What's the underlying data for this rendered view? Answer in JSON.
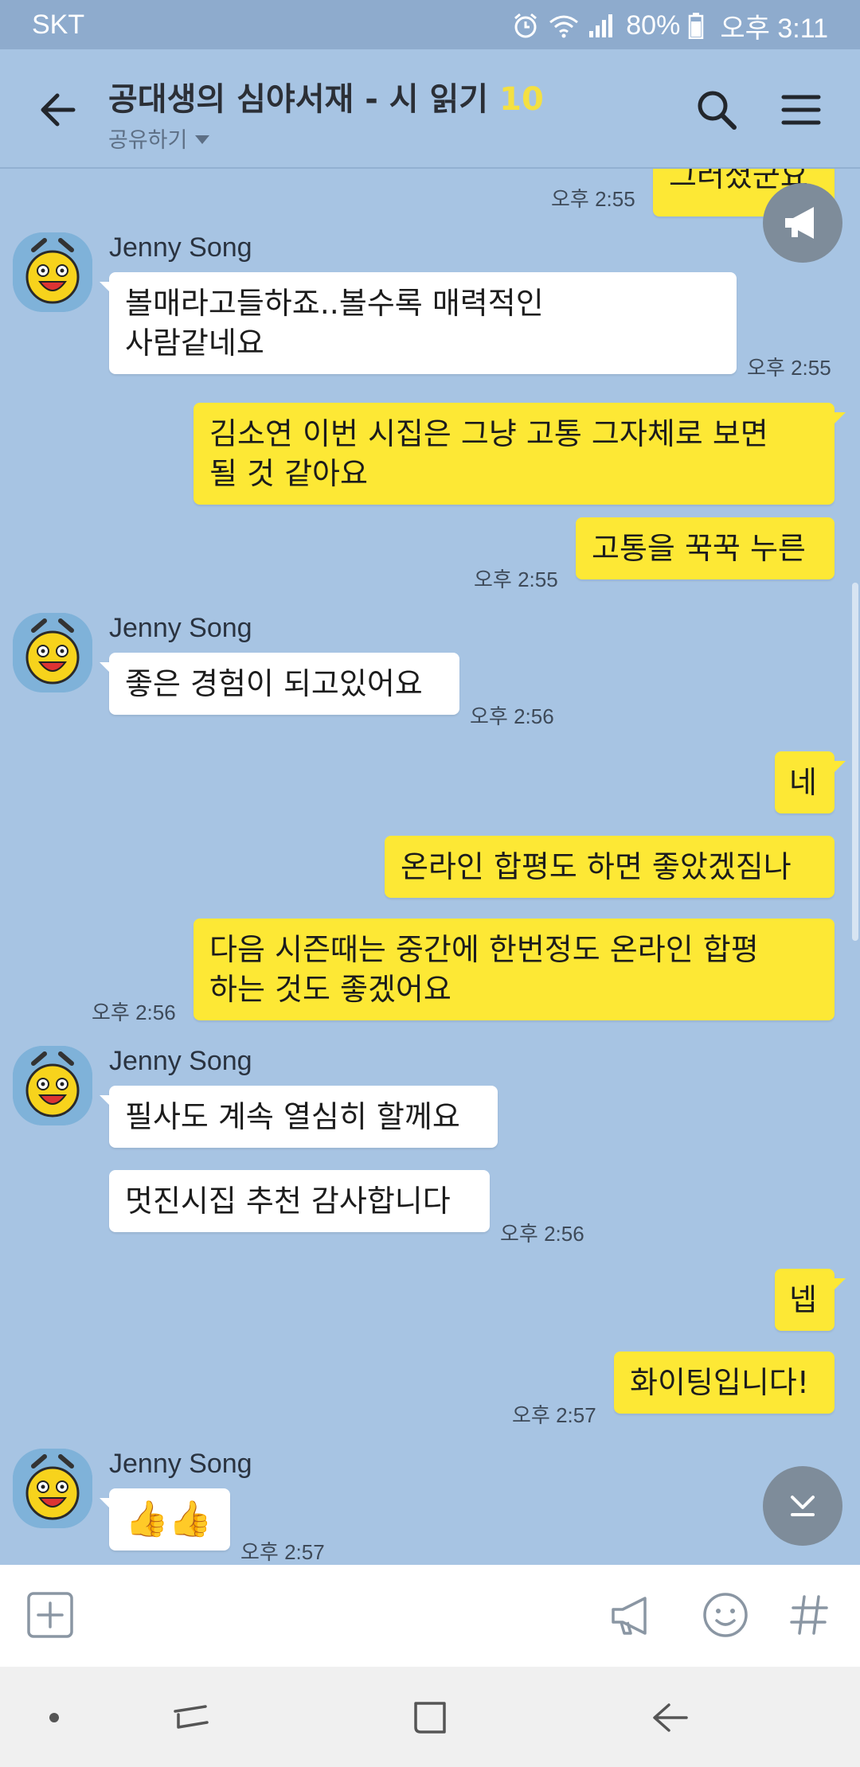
{
  "status_bar": {
    "carrier": "SKT",
    "battery": "80%",
    "time": "오후 3:11"
  },
  "header": {
    "title": "공대생의 심야서재 - 시 읽기",
    "member_count": "10",
    "share_label": "공유하기"
  },
  "messages": [
    {
      "from": "me",
      "text": "그러셨군요",
      "time": "오후 2:55"
    },
    {
      "from": "other",
      "sender": "Jenny Song",
      "text_lines": [
        "볼매라고들하죠..볼수록 매력적인",
        "사람같네요"
      ],
      "time": "오후 2:55"
    },
    {
      "from": "me",
      "text_lines": [
        "김소연 이번 시집은 그냥 고통 그자체로 보면",
        "될 것 같아요"
      ]
    },
    {
      "from": "me",
      "text": "고통을 꾹꾹 누른",
      "time": "오후 2:55"
    },
    {
      "from": "other",
      "sender": "Jenny Song",
      "text": "좋은 경험이 되고있어요",
      "time": "오후 2:56"
    },
    {
      "from": "me",
      "text": "네"
    },
    {
      "from": "me",
      "text": "온라인 합평도 하면 좋았겠짐나"
    },
    {
      "from": "me",
      "text_lines": [
        "다음 시즌때는 중간에 한번정도 온라인 합평",
        "하는 것도 좋겠어요"
      ],
      "time": "오후 2:56"
    },
    {
      "from": "other",
      "sender": "Jenny Song",
      "text": "필사도 계속 열심히 할께요"
    },
    {
      "from": "other",
      "text": "멋진시집 추천 감사합니다",
      "time": "오후 2:56"
    },
    {
      "from": "me",
      "text": "넵"
    },
    {
      "from": "me",
      "text": "화이팅입니다!",
      "time": "오후 2:57"
    },
    {
      "from": "other",
      "sender": "Jenny Song",
      "text": "👍👍",
      "time": "오후 2:57"
    }
  ],
  "input": {
    "placeholder": ""
  },
  "colors": {
    "chat_background": "#a7c4e3",
    "my_bubble": "#fde835",
    "other_bubble": "#ffffff",
    "member_count": "#f4e042"
  }
}
